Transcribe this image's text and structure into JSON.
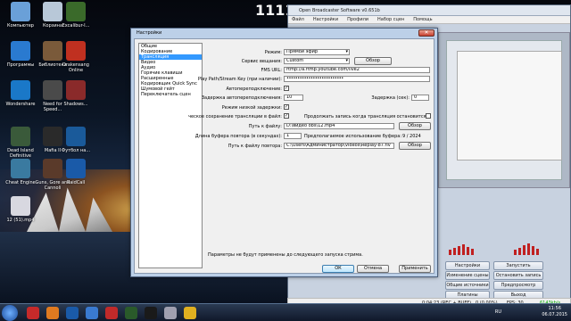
{
  "desktop": {
    "big_number": "1111",
    "icons": [
      {
        "label": "Компьютер",
        "color": "#6aa0d8"
      },
      {
        "label": "Корзина",
        "color": "#b8c8d8"
      },
      {
        "label": "Excalibur-I...",
        "color": "#3a6a2a"
      },
      {
        "label": "Программы",
        "color": "#2a7ad0"
      },
      {
        "label": "Библиотека",
        "color": "#7a5a3a"
      },
      {
        "label": "Drakensang Online",
        "color": "#c03020"
      },
      {
        "label": "Wondershare",
        "color": "#1a78c8"
      },
      {
        "label": "Need for Speed...",
        "color": "#4a4a4a"
      },
      {
        "label": "Shadows...",
        "color": "#8a2a2a"
      },
      {
        "label": "Dead Island Definitive",
        "color": "#3a5a3a"
      },
      {
        "label": "Mafia II",
        "color": "#2a2a2a"
      },
      {
        "label": "Футбол на...",
        "color": "#1a5a9a"
      },
      {
        "label": "Cheat Engine",
        "color": "#3a7aa0"
      },
      {
        "label": "Guns, Gore and Cannoli",
        "color": "#5a3a2a"
      },
      {
        "label": "RaidCall",
        "color": "#1a5aa8"
      },
      {
        "label": "12 (51).mp4",
        "color": "#d8d8e0"
      }
    ]
  },
  "obs": {
    "title": "Open Broadcaster Software v0.651b",
    "menu": [
      "Файл",
      "Настройки",
      "Профили",
      "Набор сцен",
      "Помощь"
    ],
    "buttons": {
      "settings": "Настройки",
      "start_stream": "Запустить трансляцию",
      "edit_scene": "Изменение сцены",
      "stop_record": "Остановить запись",
      "global_sources": "Общие источники",
      "preview": "Предпросмотр",
      "plugins": "Плагины",
      "exit": "Выход"
    },
    "status": {
      "time": "0:04:23 (REC + BUFF)",
      "dropped": "0 (0.00%)",
      "fps": "FPS: 30",
      "bitrate": "6143kb/s"
    }
  },
  "dialog": {
    "title": "Настройки",
    "categories": [
      "Общие",
      "Кодирование",
      "Трансляция",
      "Видео",
      "Аудио",
      "Горячие клавиши",
      "Расширенные",
      "Кодировщик Quick Sync",
      "Шумовой гейт",
      "Переключатель сцен"
    ],
    "selected_category": 2,
    "mode_label": "Режим:",
    "mode_value": "Прямой эфир",
    "service_label": "Сервис вещания:",
    "service_value": "Custom",
    "browse_button": "Обзор",
    "fms_label": "FMS URL:",
    "fms_value": "rtmp://a.rtmp.youtube.com/live2",
    "key_label": "Play Path/Stream Key (при наличии):",
    "key_value": "••••••••••••••••••••••••••",
    "autoreconnect_label": "Автопереподключение:",
    "autoreconnect_checked": true,
    "reconnect_delay_label": "Задержка автопереподключения:",
    "reconnect_delay_value": "10",
    "delay_label": "Задержка (сек):",
    "delay_value": "0",
    "low_latency_label": "Режим низкой задержки:",
    "low_latency_checked": true,
    "save_file_label": "ческое сохранение трансляции в файл:",
    "save_file_checked": true,
    "continue_record_label": "Продолжать запись когда трансляция остановится:",
    "continue_record_checked": false,
    "path_label": "Путь к файлу:",
    "path_value": "D:\\видео obs\\12.mp4",
    "path_browse": "Обзор",
    "replay_buffer_label": "Длина буфера повтора (в секундах):",
    "replay_buffer_value": "1",
    "buffer_usage_label": "Предполагаемое использование буфера:",
    "buffer_usage_value": "9 / 2024",
    "replay_path_label": "Путь к файлу повтора:",
    "replay_path_value": "C:\\Users\\Администратор\\Videos\\Replay-87.flv",
    "replay_browse": "Обзор",
    "note": "Параметры не будут применены до следующего запуска стрима.",
    "ok": "ОК",
    "cancel": "Отмена",
    "apply": "Применить"
  },
  "taskbar": {
    "lang": "RU",
    "time": "11:56",
    "date": "06.07.2015"
  }
}
